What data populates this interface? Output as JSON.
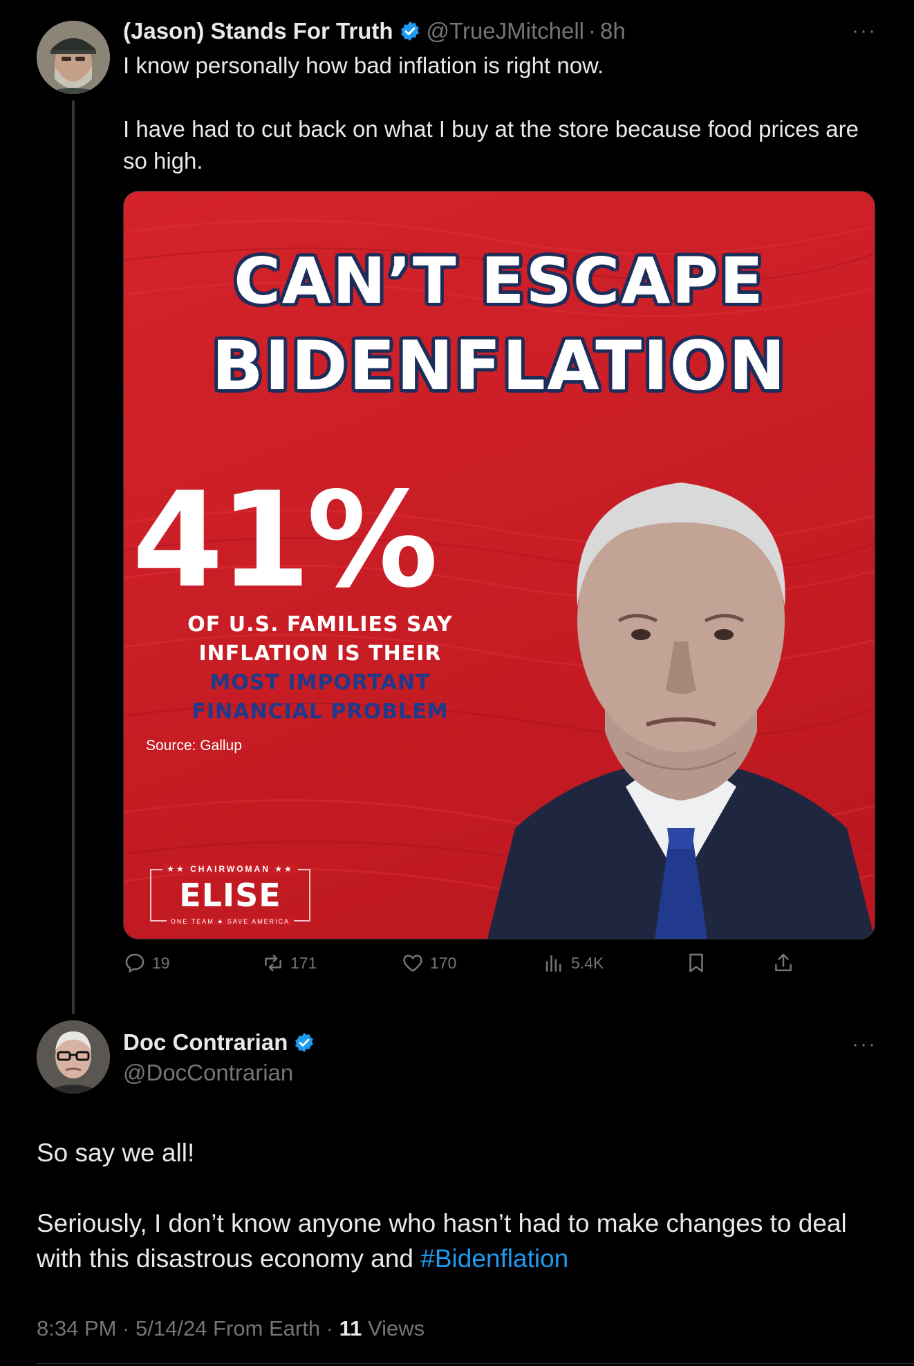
{
  "tweet1": {
    "display_name": "(Jason) Stands For Truth",
    "handle": "@TrueJMitchell",
    "time": "8h",
    "separator": "·",
    "paragraphs": [
      "I know personally how bad inflation is right now.",
      "I have had to cut back on what I buy at the store because food prices are so high."
    ],
    "more": "···",
    "media": {
      "headline_line1": "CAN’T ESCAPE",
      "headline_line2": "BIDENFLATION",
      "stat_value": "41%",
      "stat_line1": "OF U.S. FAMILIES SAY",
      "stat_line2": "INFLATION IS THEIR",
      "stat_line3": "MOST IMPORTANT",
      "stat_line4": "FINANCIAL PROBLEM",
      "source": "Source: Gallup",
      "logo_top": "★★ CHAIRWOMAN ★★",
      "logo_main": "ELISE",
      "logo_bottom": "ONE TEAM ★ SAVE AMERICA"
    },
    "actions": {
      "replies": "19",
      "reposts": "171",
      "likes": "170",
      "views": "5.4K"
    }
  },
  "tweet2": {
    "display_name": "Doc Contrarian",
    "handle": "@DocContrarian",
    "more": "···",
    "paragraph1": "So say we all!",
    "paragraph2_text": "Seriously, I don’t know anyone who hasn’t had to make changes to deal with this disastrous economy and ",
    "hashtag": "#Bidenflation",
    "meta_time": "8:34 PM · 5/14/24 From Earth · ",
    "views_count": "11",
    "views_label": " Views"
  },
  "colors": {
    "background": "#000000",
    "text": "#e7e9ea",
    "muted": "#71767b",
    "accent": "#1d9bf0",
    "media_red": "#c81d25",
    "media_navy": "#1c2d5a"
  }
}
